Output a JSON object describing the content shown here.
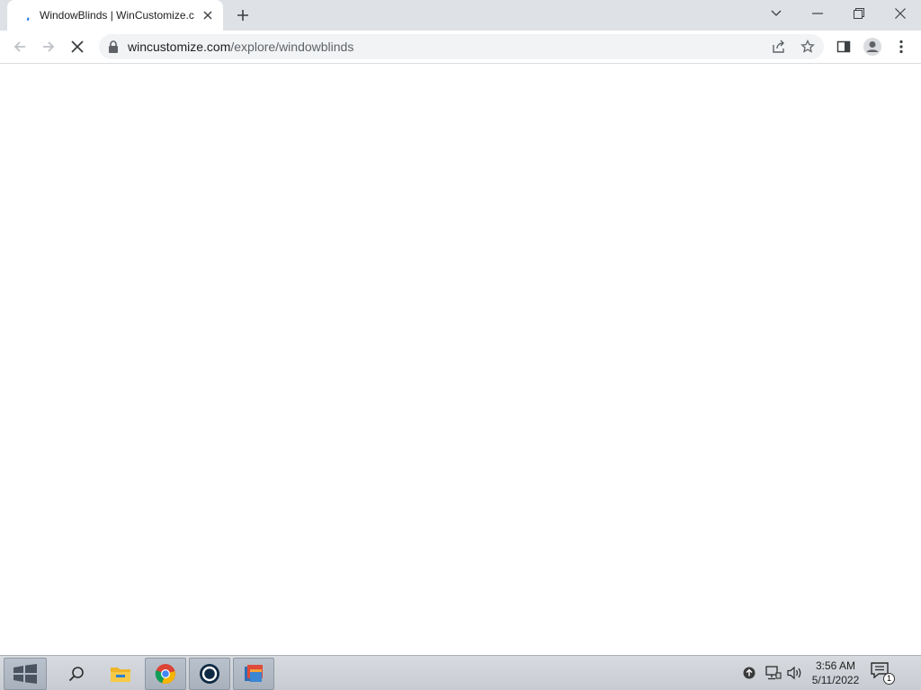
{
  "browser": {
    "tab": {
      "title": "WindowBlinds | WinCustomize.com",
      "favicon": "loading-spinner-icon",
      "close_icon": "close-icon"
    },
    "new_tab_icon": "plus-icon",
    "window_controls": [
      "chevron-down-icon",
      "minimize-icon",
      "restore-icon",
      "close-icon"
    ],
    "toolbar": {
      "back_icon": "arrow-left-icon",
      "forward_icon": "arrow-right-icon",
      "stop_icon": "close-icon",
      "url_host": "wincustomize.com",
      "url_path": "/explore/windowblinds",
      "share_icon": "share-icon",
      "bookmark_icon": "star-icon",
      "side_panel_icon": "side-panel-icon",
      "profile_icon": "profile-icon",
      "menu_icon": "kebab-menu-icon"
    }
  },
  "taskbar": {
    "start_icon": "start-icon",
    "search_icon": "search-icon",
    "apps": [
      "file-explorer-icon",
      "chrome-icon",
      "circle-app-icon",
      "windowblinds-icon"
    ],
    "tray": {
      "upload_icon": "arrow-up-icon",
      "network_icon": "network-icon",
      "volume_icon": "volume-icon"
    },
    "time": "3:56 AM",
    "date": "5/11/2022",
    "notification_count": "1"
  },
  "colors": {
    "tabstrip_bg": "#dee1e6",
    "omnibox_bg": "#f1f3f4",
    "taskbar_bg": "#c8ccd2"
  }
}
